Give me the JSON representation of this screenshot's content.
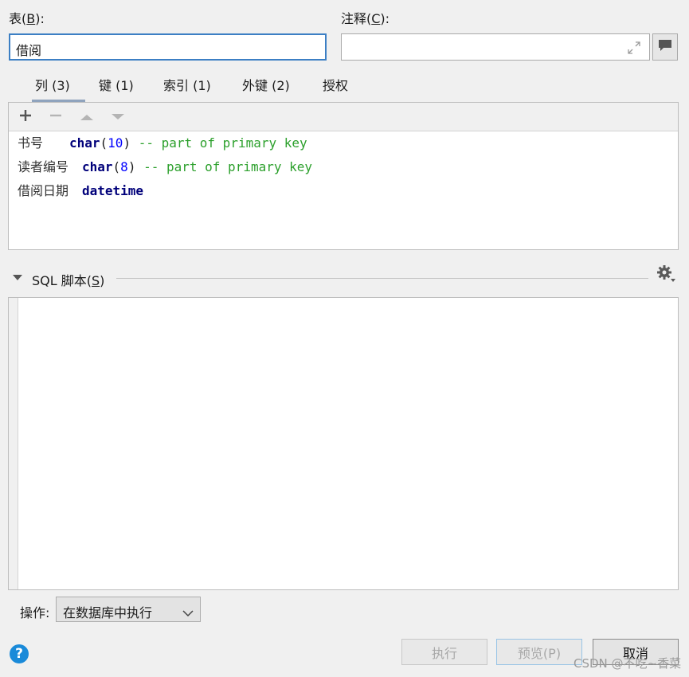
{
  "header": {
    "table_label": "表(",
    "table_key": "B",
    "table_label_end": "):",
    "table_value": "借阅",
    "comment_label": "注释(",
    "comment_key": "C",
    "comment_label_end": "):",
    "comment_value": ""
  },
  "tabs": [
    {
      "label": "列 (3)",
      "active": true
    },
    {
      "label": "键 (1)"
    },
    {
      "label": "索引 (1)"
    },
    {
      "label": "外键 (2)"
    },
    {
      "label": "授权"
    }
  ],
  "columns": [
    {
      "name": "书号",
      "type": "char",
      "open": "(",
      "size": "10",
      "close": ")",
      "comment": "-- part of primary key"
    },
    {
      "name": "读者编号",
      "type": "char",
      "open": "(",
      "size": "8",
      "close": ")",
      "comment": "-- part of primary key"
    },
    {
      "name": "借阅日期",
      "type": "datetime",
      "open": "",
      "size": "",
      "close": "",
      "comment": ""
    }
  ],
  "sql": {
    "header_label": "SQL 脚本(",
    "header_key": "S",
    "header_label_end": ")",
    "content": ""
  },
  "footer": {
    "op_label": "操作:",
    "op_value": "在数据库中执行",
    "run_label": "执行",
    "preview_label": "预览(P)",
    "cancel_label": "取消",
    "help_label": "?"
  },
  "watermark": "CSDN @不吃~香菜",
  "colors": {
    "accent": "#3c7fc4",
    "keyword": "#00007a",
    "number": "#0000ff",
    "comment": "#2ca02c"
  }
}
